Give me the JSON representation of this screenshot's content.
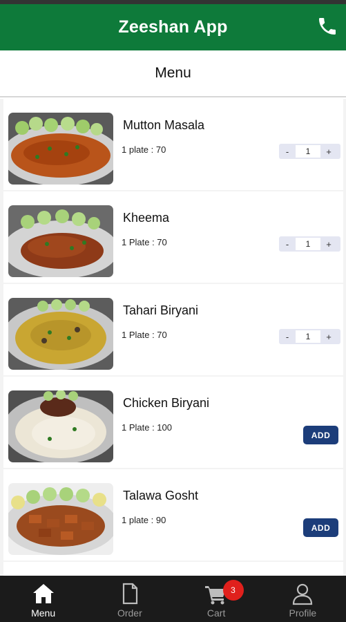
{
  "header": {
    "title": "Zeeshan App",
    "call_icon": "phone-icon"
  },
  "section": {
    "title": "Menu"
  },
  "menu_items": [
    {
      "name": "Mutton Masala",
      "price": "1 plate : 70",
      "control": "stepper",
      "quantity": "1"
    },
    {
      "name": "Kheema",
      "price": "1 Plate : 70",
      "control": "stepper",
      "quantity": "1"
    },
    {
      "name": "Tahari Biryani",
      "price": "1 Plate : 70",
      "control": "stepper",
      "quantity": "1"
    },
    {
      "name": "Chicken Biryani",
      "price": "1 Plate : 100",
      "control": "add",
      "add_label": "ADD"
    },
    {
      "name": "Talawa Gosht",
      "price": "1 plate : 90",
      "control": "add",
      "add_label": "ADD"
    }
  ],
  "stepper": {
    "minus": "-",
    "plus": "+"
  },
  "bottom_nav": {
    "items": [
      {
        "label": "Menu",
        "icon": "home-icon",
        "active": true
      },
      {
        "label": "Order",
        "icon": "document-icon",
        "active": false
      },
      {
        "label": "Cart",
        "icon": "cart-icon",
        "active": false
      },
      {
        "label": "Profile",
        "icon": "user-icon",
        "active": false
      }
    ],
    "cart_badge": "3"
  },
  "colors": {
    "header_bg": "#0e7a3a",
    "nav_bg": "#1b1b1b",
    "add_button": "#1c3d7a",
    "badge": "#e0201c",
    "stepper_bg": "#e4e6f2"
  }
}
